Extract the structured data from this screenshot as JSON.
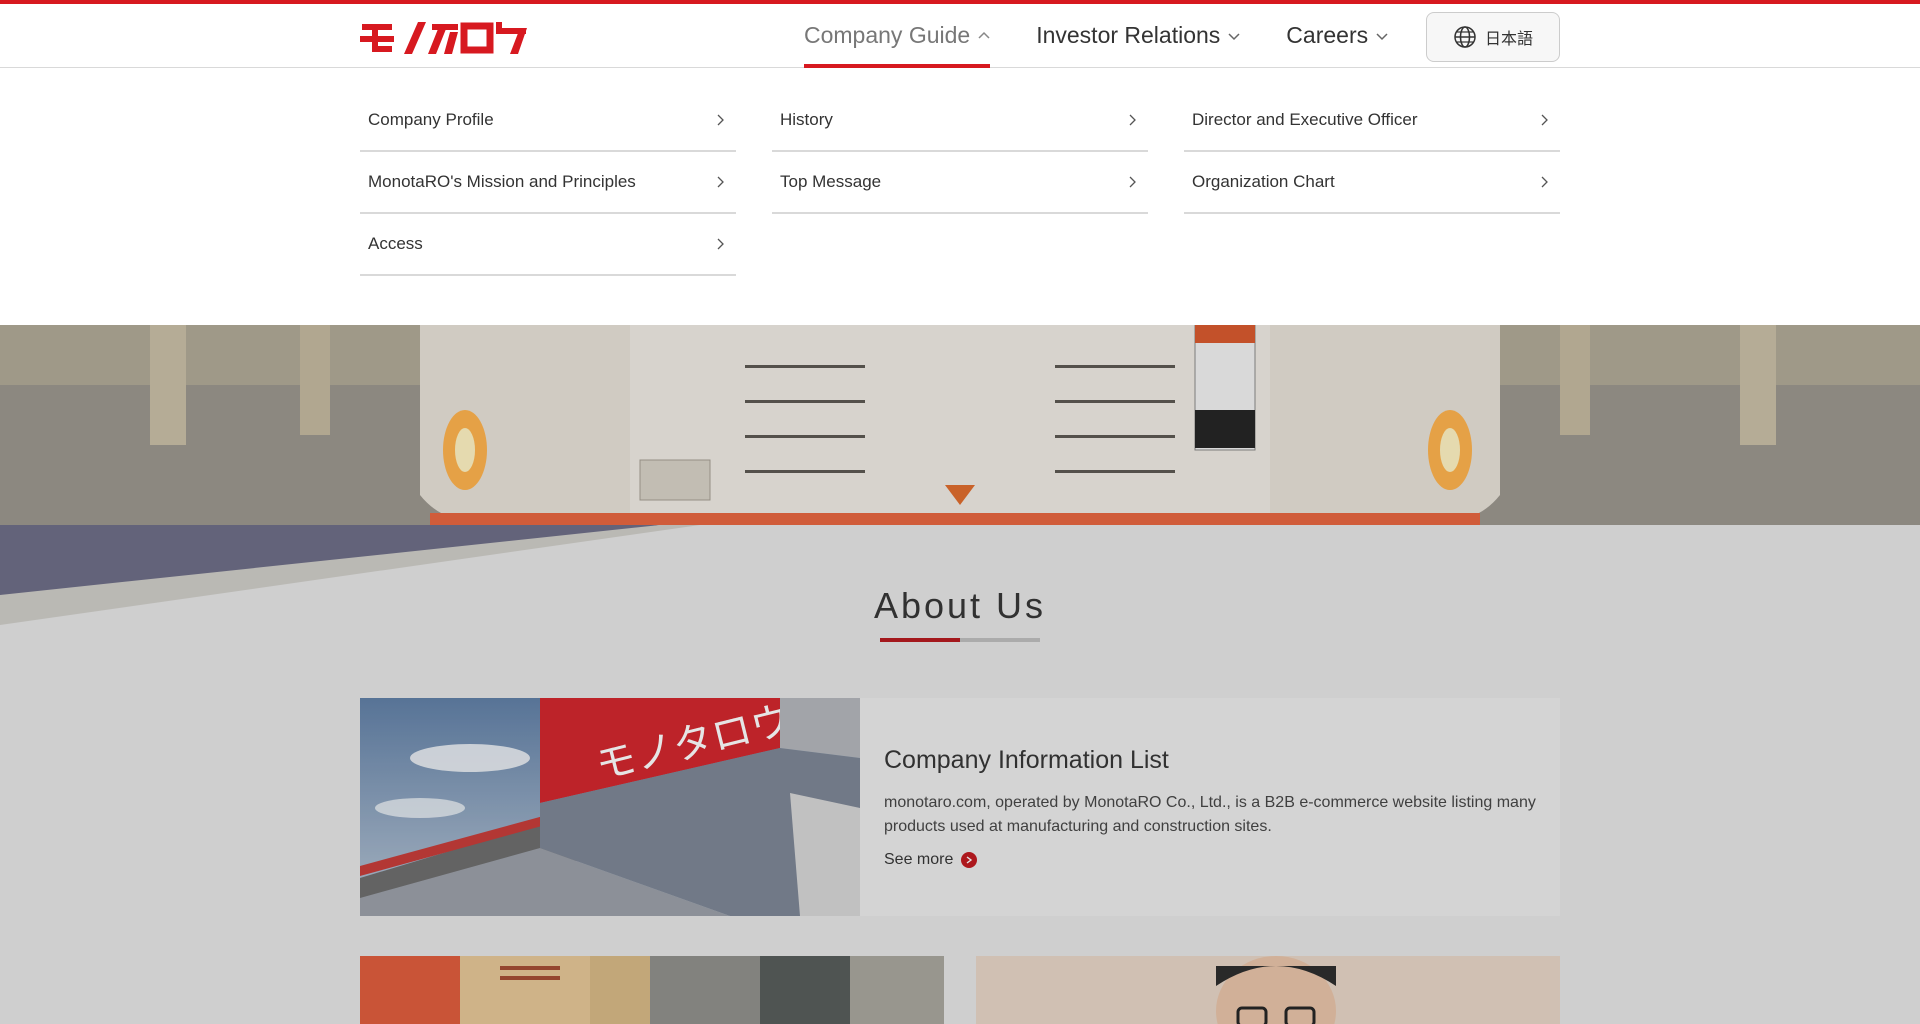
{
  "brand": {
    "logo_text": "モノタロウ",
    "accent_color": "#d71920"
  },
  "nav": {
    "items": [
      {
        "label": "Company Guide",
        "state": "expanded"
      },
      {
        "label": "Investor Relations",
        "state": "collapsed"
      },
      {
        "label": "Careers",
        "state": "collapsed"
      }
    ],
    "language_button": {
      "label": "日本語",
      "icon": "globe-icon"
    }
  },
  "dropdown": {
    "items": [
      {
        "label": "Company Profile"
      },
      {
        "label": "History"
      },
      {
        "label": "Director and Executive Officer"
      },
      {
        "label": "MonotaRO's Mission and Principles"
      },
      {
        "label": "Top Message"
      },
      {
        "label": "Organization Chart"
      },
      {
        "label": "Access"
      }
    ]
  },
  "about": {
    "title": "About Us",
    "card": {
      "heading": "Company Information List",
      "description": "monotaro.com, operated by MonotaRO Co., Ltd., is a B2B e-commerce website listing many products used at manufacturing and construction sites.",
      "link_label": "See more"
    }
  }
}
